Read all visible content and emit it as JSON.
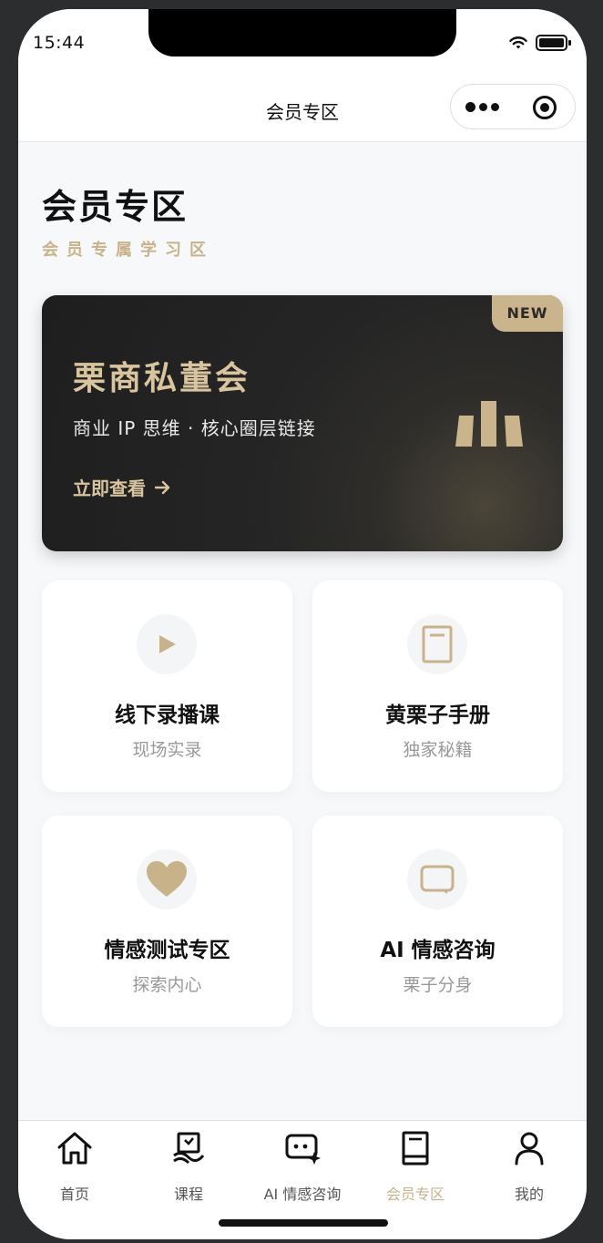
{
  "status": {
    "time": "15:44"
  },
  "nav": {
    "title": "会员专区"
  },
  "page": {
    "title": "会员专区",
    "subtitle": "会员专属学习区"
  },
  "banner": {
    "badge": "NEW",
    "title": "栗商私董会",
    "desc": "商业 IP 思维 · 核心圈层链接",
    "link": "立即查看"
  },
  "cards": [
    {
      "title": "线下录播课",
      "sub": "现场实录",
      "icon": "play-icon"
    },
    {
      "title": "黄栗子手册",
      "sub": "独家秘籍",
      "icon": "book-icon"
    },
    {
      "title": "情感测试专区",
      "sub": "探索内心",
      "icon": "heart-icon"
    },
    {
      "title": "AI 情感咨询",
      "sub": "栗子分身",
      "icon": "chat-icon"
    }
  ],
  "tabs": [
    {
      "label": "首页",
      "icon": "home-icon"
    },
    {
      "label": "课程",
      "icon": "course-icon"
    },
    {
      "label": "AI 情感咨询",
      "icon": "ai-chat-icon"
    },
    {
      "label": "会员专区",
      "icon": "member-book-icon",
      "active": true
    },
    {
      "label": "我的",
      "icon": "profile-icon"
    }
  ],
  "colors": {
    "accent": "#c8b389",
    "banner_bg": "#1f1f1f",
    "text": "#111111"
  }
}
